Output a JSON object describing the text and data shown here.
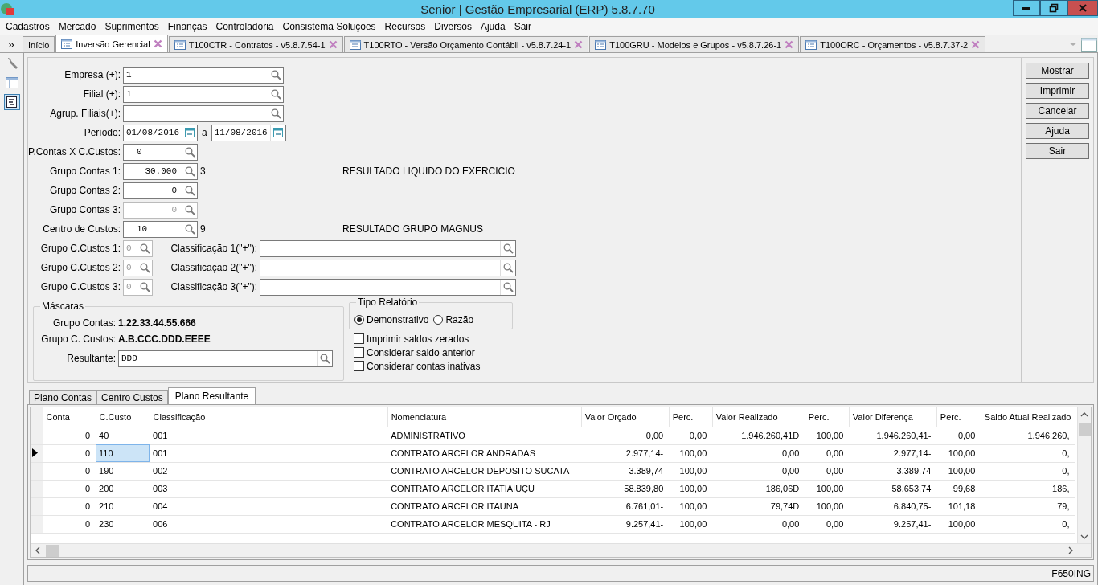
{
  "window": {
    "title": "Senior | Gestão Empresarial (ERP) 5.8.7.70"
  },
  "menu": [
    "Cadastros",
    "Mercado",
    "Suprimentos",
    "Finanças",
    "Controladoria",
    "Consistema Soluções",
    "Recursos",
    "Diversos",
    "Ajuda",
    "Sair"
  ],
  "tabs_toggle": "»",
  "tabs": [
    {
      "label": "Início",
      "kind": "plain",
      "selected": false
    },
    {
      "label": "Inversão Gerencial",
      "kind": "form",
      "selected": true
    },
    {
      "label": "T100CTR - Contratos - v5.8.7.54-1",
      "kind": "form",
      "selected": false
    },
    {
      "label": "T100RTO -  Versão Orçamento Contábil - v5.8.7.24-1",
      "kind": "form",
      "selected": false
    },
    {
      "label": "T100GRU - Modelos e Grupos - v5.8.7.26-1",
      "kind": "form",
      "selected": false
    },
    {
      "label": "T100ORC - Orçamentos - v5.8.7.37-2",
      "kind": "form",
      "selected": false
    }
  ],
  "toolbar": [
    {
      "kind": "wrench",
      "selected": false
    },
    {
      "kind": "layout",
      "selected": false
    },
    {
      "kind": "report",
      "selected": true
    }
  ],
  "filters": [
    {
      "kind": "lookup",
      "label": "Empresa (+):",
      "value": "1"
    },
    {
      "kind": "lookup",
      "label": "Filial (+):",
      "value": "1"
    },
    {
      "kind": "lookup",
      "label": "Agrup. Filiais(+):"
    },
    {
      "kind": "period",
      "label": "Período:",
      "from": "01/08/2016",
      "separator": "a",
      "to": "11/08/2016"
    },
    {
      "kind": "code",
      "label": "P.Contas X C.Custos:",
      "value": "0",
      "disabled": false
    },
    {
      "kind": "numeric",
      "label": "Grupo Contas 1:",
      "value": "30.000",
      "disabled": false,
      "extra": "3",
      "description": "RESULTADO LIQUIDO DO EXERCICIO"
    },
    {
      "kind": "numeric",
      "label": "Grupo Contas 2:",
      "value": "0",
      "disabled": false
    },
    {
      "kind": "numeric",
      "label": "Grupo Contas 3:",
      "value": "0",
      "disabled": true
    },
    {
      "kind": "code",
      "label": "Centro de Custos:",
      "value": "10",
      "disabled": false,
      "extra": "9",
      "description": "RESULTADO GRUPO MAGNUS"
    },
    {
      "kind": "pair",
      "label": "Grupo C.Custos 1:",
      "value": "0",
      "label2": "Classificação 1(\"+\"):"
    },
    {
      "kind": "pair",
      "label": "Grupo C.Custos 2:",
      "value": "0",
      "label2": "Classificação 2(\"+\"):"
    },
    {
      "kind": "pair",
      "label": "Grupo C.Custos 3:",
      "value": "0",
      "label2": "Classificação 3(\"+\"):"
    }
  ],
  "masks": {
    "title": "Máscaras",
    "rows": [
      {
        "label": "Grupo Contas:",
        "value": "1.22.33.44.55.666"
      },
      {
        "label": "Grupo C. Custos:",
        "value": "A.B.CCC.DDD.EEEE"
      }
    ],
    "result_label": "Resultante:",
    "result_value": "DDD"
  },
  "report_type": {
    "title": "Tipo Relatório",
    "options": [
      {
        "label": "Demonstrativo",
        "selected": true
      },
      {
        "label": "Razão",
        "selected": false
      }
    ]
  },
  "options": [
    {
      "label": "Imprimir saldos zerados",
      "checked": false
    },
    {
      "label": "Considerar saldo anterior",
      "checked": false
    },
    {
      "label": "Considerar contas inativas",
      "checked": false
    }
  ],
  "buttons": [
    "Mostrar",
    "Imprimir",
    "Cancelar",
    "Ajuda",
    "Sair"
  ],
  "result_tabs": [
    {
      "label": "Plano Contas",
      "selected": false
    },
    {
      "label": "Centro Custos",
      "selected": false
    },
    {
      "label": "Plano Resultante",
      "selected": true
    }
  ],
  "table": {
    "columns": [
      {
        "label": "Conta",
        "kind": "number"
      },
      {
        "label": "C.Custo",
        "kind": "text"
      },
      {
        "label": "Classificação",
        "kind": "text"
      },
      {
        "label": "Nomenclatura",
        "kind": "text"
      },
      {
        "label": "Valor Orçado",
        "kind": "number"
      },
      {
        "label": "Perc.",
        "kind": "number"
      },
      {
        "label": "Valor Realizado",
        "kind": "number"
      },
      {
        "label": "Perc.",
        "kind": "number"
      },
      {
        "label": "Valor Diferença",
        "kind": "number"
      },
      {
        "label": "Perc.",
        "kind": "number"
      },
      {
        "label": "Saldo Atual Realizado",
        "kind": "number"
      }
    ],
    "rows": [
      {
        "selected": false,
        "cells": [
          "0",
          "40",
          "001",
          "ADMINISTRATIVO",
          "0,00",
          "0,00",
          "1.946.260,41D",
          "100,00",
          "1.946.260,41-",
          "0,00",
          "1.946.260,"
        ]
      },
      {
        "selected": true,
        "cells": [
          "0",
          "110",
          "001",
          "CONTRATO ARCELOR ANDRADAS",
          "2.977,14-",
          "100,00",
          "0,00",
          "0,00",
          "2.977,14-",
          "100,00",
          "0,"
        ]
      },
      {
        "selected": false,
        "cells": [
          "0",
          "190",
          "002",
          "CONTRATO ARCELOR DEPOSITO SUCATA",
          "3.389,74",
          "100,00",
          "0,00",
          "0,00",
          "3.389,74",
          "100,00",
          "0,"
        ]
      },
      {
        "selected": false,
        "cells": [
          "0",
          "200",
          "003",
          "CONTRATO ARCELOR ITATIAIUÇU",
          "58.839,80",
          "100,00",
          "186,06D",
          "100,00",
          "58.653,74",
          "99,68",
          "186,"
        ]
      },
      {
        "selected": false,
        "cells": [
          "0",
          "210",
          "004",
          "CONTRATO ARCELOR ITAUNA",
          "6.761,01-",
          "100,00",
          "79,74D",
          "100,00",
          "6.840,75-",
          "101,18",
          "79,"
        ]
      },
      {
        "selected": false,
        "cells": [
          "0",
          "230",
          "006",
          "CONTRATO ARCELOR MESQUITA - RJ",
          "9.257,41-",
          "100,00",
          "0,00",
          "0,00",
          "9.257,41-",
          "100,00",
          "0,"
        ]
      }
    ]
  },
  "status_bar": {
    "code": "F650ING"
  }
}
